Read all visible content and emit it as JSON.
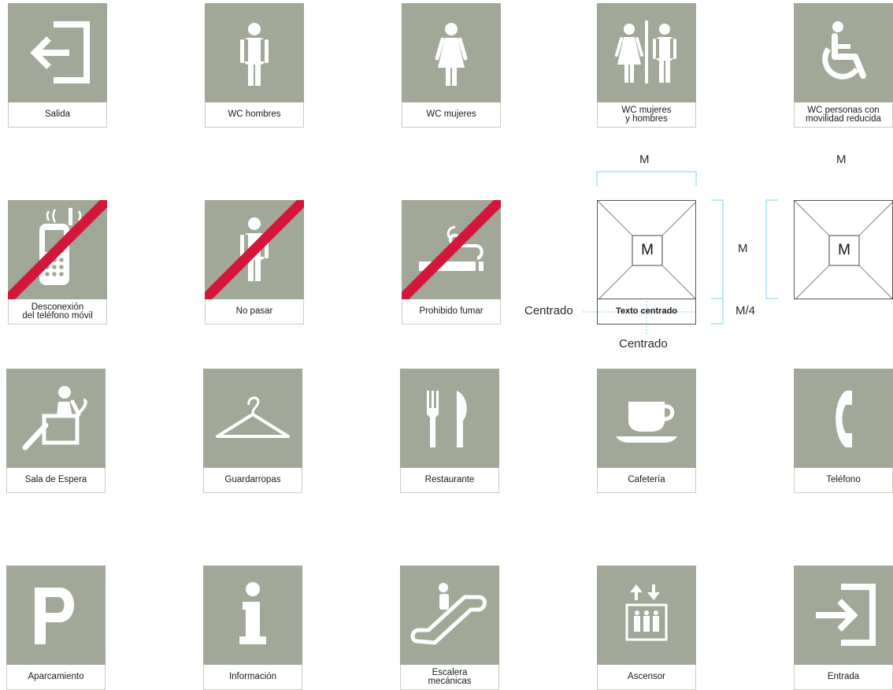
{
  "signs": [
    {
      "label": "Salida",
      "icon": "exit-arrow-left-icon"
    },
    {
      "label": "WC hombres",
      "icon": "man-icon"
    },
    {
      "label": "WC mujeres",
      "icon": "woman-icon"
    },
    {
      "label": "WC mujeres\ny hombres",
      "icon": "woman-man-icon"
    },
    {
      "label": "WC personas con\nmovilidad reducida",
      "icon": "wheelchair-icon"
    },
    {
      "label": "Desconexión\ndel teléfono móvil",
      "icon": "no-mobile-phone-icon"
    },
    {
      "label": "No pasar",
      "icon": "no-entry-person-icon"
    },
    {
      "label": "Prohibido fumar",
      "icon": "no-smoking-icon"
    },
    {
      "label": "Sala de Espera",
      "icon": "waiting-room-icon"
    },
    {
      "label": "Guardarropas",
      "icon": "coat-hanger-icon"
    },
    {
      "label": "Restaurante",
      "icon": "fork-knife-icon"
    },
    {
      "label": "Cafetería",
      "icon": "coffee-cup-icon"
    },
    {
      "label": "Teléfono",
      "icon": "phone-handset-icon"
    },
    {
      "label": "Aparcamiento",
      "icon": "parking-icon"
    },
    {
      "label": "Información",
      "icon": "information-icon"
    },
    {
      "label": "Escalera\nmecánicas",
      "icon": "escalator-icon"
    },
    {
      "label": "Ascensor",
      "icon": "elevator-icon"
    },
    {
      "label": "Entrada",
      "icon": "entrance-arrow-right-icon"
    }
  ],
  "construction": {
    "m_label": "M",
    "quarter_label": "M/4",
    "centered_label": "Centrado",
    "sample_text": "Texto centrado"
  },
  "colors": {
    "panel": "#a2a897",
    "prohibition": "#d2173a",
    "guide": "#7ad3ea"
  }
}
